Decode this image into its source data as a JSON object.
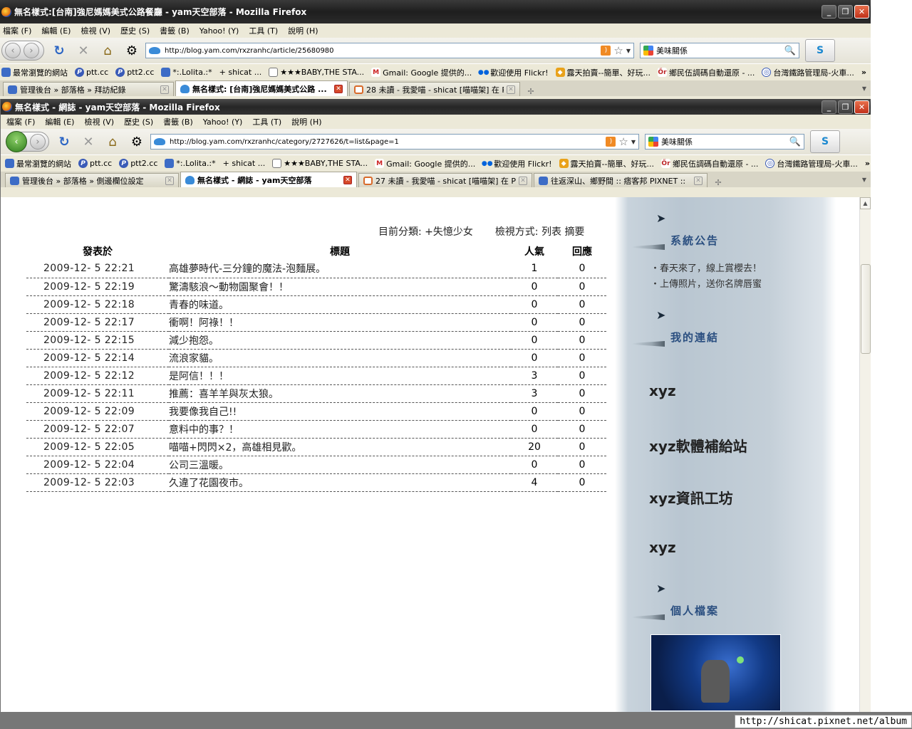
{
  "win1": {
    "title": "無名樣式:[台南]強尼媽媽美式公路餐廳 - yam天空部落 - Mozilla Firefox",
    "menu": [
      "檔案 (F)",
      "編輯 (E)",
      "檢視 (V)",
      "歷史 (S)",
      "書籤 (B)",
      "Yahoo! (Y)",
      "工具 (T)",
      "說明 (H)"
    ],
    "url": "http://blog.yam.com/rxzranhc/article/25680980",
    "search": "美味關係",
    "bookmarks": [
      "最常瀏覽的網站",
      "ptt.cc",
      "ptt2.cc",
      "*:.Lolita.:*",
      "+ shicat ...",
      "★★★BABY,THE STA...",
      "Gmail: Google 提供的...",
      "歡迎使用 Flickr!",
      "露天拍賣--簡單、好玩...",
      "鄉民伍調碼自動還原 - ...",
      "台灣鐵路管理局-火車..."
    ],
    "tabs": [
      "管理後台 » 部落格 » 拜訪紀錄",
      "無名樣式: [台南]強尼媽媽美式公路 ...",
      "28 未讀 - 我愛喵 - shicat [喵喵架] 在 Plu..."
    ]
  },
  "win2": {
    "title": "無名樣式 - 網誌 - yam天空部落 - Mozilla Firefox",
    "menu": [
      "檔案 (F)",
      "編輯 (E)",
      "檢視 (V)",
      "歷史 (S)",
      "書籤 (B)",
      "Yahoo! (Y)",
      "工具 (T)",
      "說明 (H)"
    ],
    "url": "http://blog.yam.com/rxzranhc/category/2727626/t=list&page=1",
    "search": "美味關係",
    "bookmarks": [
      "最常瀏覽的網站",
      "ptt.cc",
      "ptt2.cc",
      "*:.Lolita.:*",
      "+ shicat ...",
      "★★★BABY,THE STA...",
      "Gmail: Google 提供的...",
      "歡迎使用 Flickr!",
      "露天拍賣--簡單、好玩...",
      "鄉民伍調碼自動還原 - ...",
      "台灣鐵路管理局-火車..."
    ],
    "tabs": [
      "管理後台 » 部落格 » 側邊欄位設定",
      "無名樣式 - 網誌 - yam天空部落",
      "27 未讀 - 我愛喵 - shicat [喵喵架] 在 Plu...",
      "往返深山、鄉野間 :: 痞客邦 PIXNET ::"
    ]
  },
  "page": {
    "category_label": "目前分類:",
    "category_value": "+失憶少女",
    "view_label": "檢視方式:",
    "view_list": "列表",
    "view_summary": "摘要",
    "headers": {
      "date": "發表於",
      "title": "標題",
      "popularity": "人氣",
      "replies": "回應"
    },
    "posts": [
      {
        "date": "2009-12- 5 22:21",
        "title": "高雄夢時代-三分鐘的魔法-泡麵展。",
        "pop": "1",
        "rep": "0"
      },
      {
        "date": "2009-12- 5 22:19",
        "title": "驚濤駭浪～動物園聚會！！",
        "pop": "0",
        "rep": "0"
      },
      {
        "date": "2009-12- 5 22:18",
        "title": "青春的味道。",
        "pop": "0",
        "rep": "0"
      },
      {
        "date": "2009-12- 5 22:17",
        "title": "衝啊！阿祿！！",
        "pop": "0",
        "rep": "0"
      },
      {
        "date": "2009-12- 5 22:15",
        "title": "減少抱怨。",
        "pop": "0",
        "rep": "0"
      },
      {
        "date": "2009-12- 5 22:14",
        "title": "流浪家貓。",
        "pop": "0",
        "rep": "0"
      },
      {
        "date": "2009-12- 5 22:12",
        "title": "是阿信！！！",
        "pop": "3",
        "rep": "0"
      },
      {
        "date": "2009-12- 5 22:11",
        "title": "推薦：喜羊羊與灰太狼。",
        "pop": "3",
        "rep": "0"
      },
      {
        "date": "2009-12- 5 22:09",
        "title": "我要像我自己!!",
        "pop": "0",
        "rep": "0"
      },
      {
        "date": "2009-12- 5 22:07",
        "title": "意料中的事？！",
        "pop": "0",
        "rep": "0"
      },
      {
        "date": "2009-12- 5 22:05",
        "title": "喵喵+閃閃×2，高雄相見歡。",
        "pop": "20",
        "rep": "0"
      },
      {
        "date": "2009-12- 5 22:04",
        "title": "公司三溫暖。",
        "pop": "0",
        "rep": "0"
      },
      {
        "date": "2009-12- 5 22:03",
        "title": "久違了花園夜市。",
        "pop": "4",
        "rep": "0"
      }
    ]
  },
  "sidebar": {
    "announce_title": "系統公告",
    "announce_items": [
      "・春天來了，線上賞櫻去！",
      "・上傳照片，送你名牌唇蜜"
    ],
    "links_title": "我的連結",
    "links": [
      "xyz",
      "xyz軟體補給站",
      "xyz資訊工坊",
      "xyz"
    ],
    "profile_title": "個人檔案"
  },
  "status": {
    "url": "http://shicat.pixnet.net/album"
  }
}
